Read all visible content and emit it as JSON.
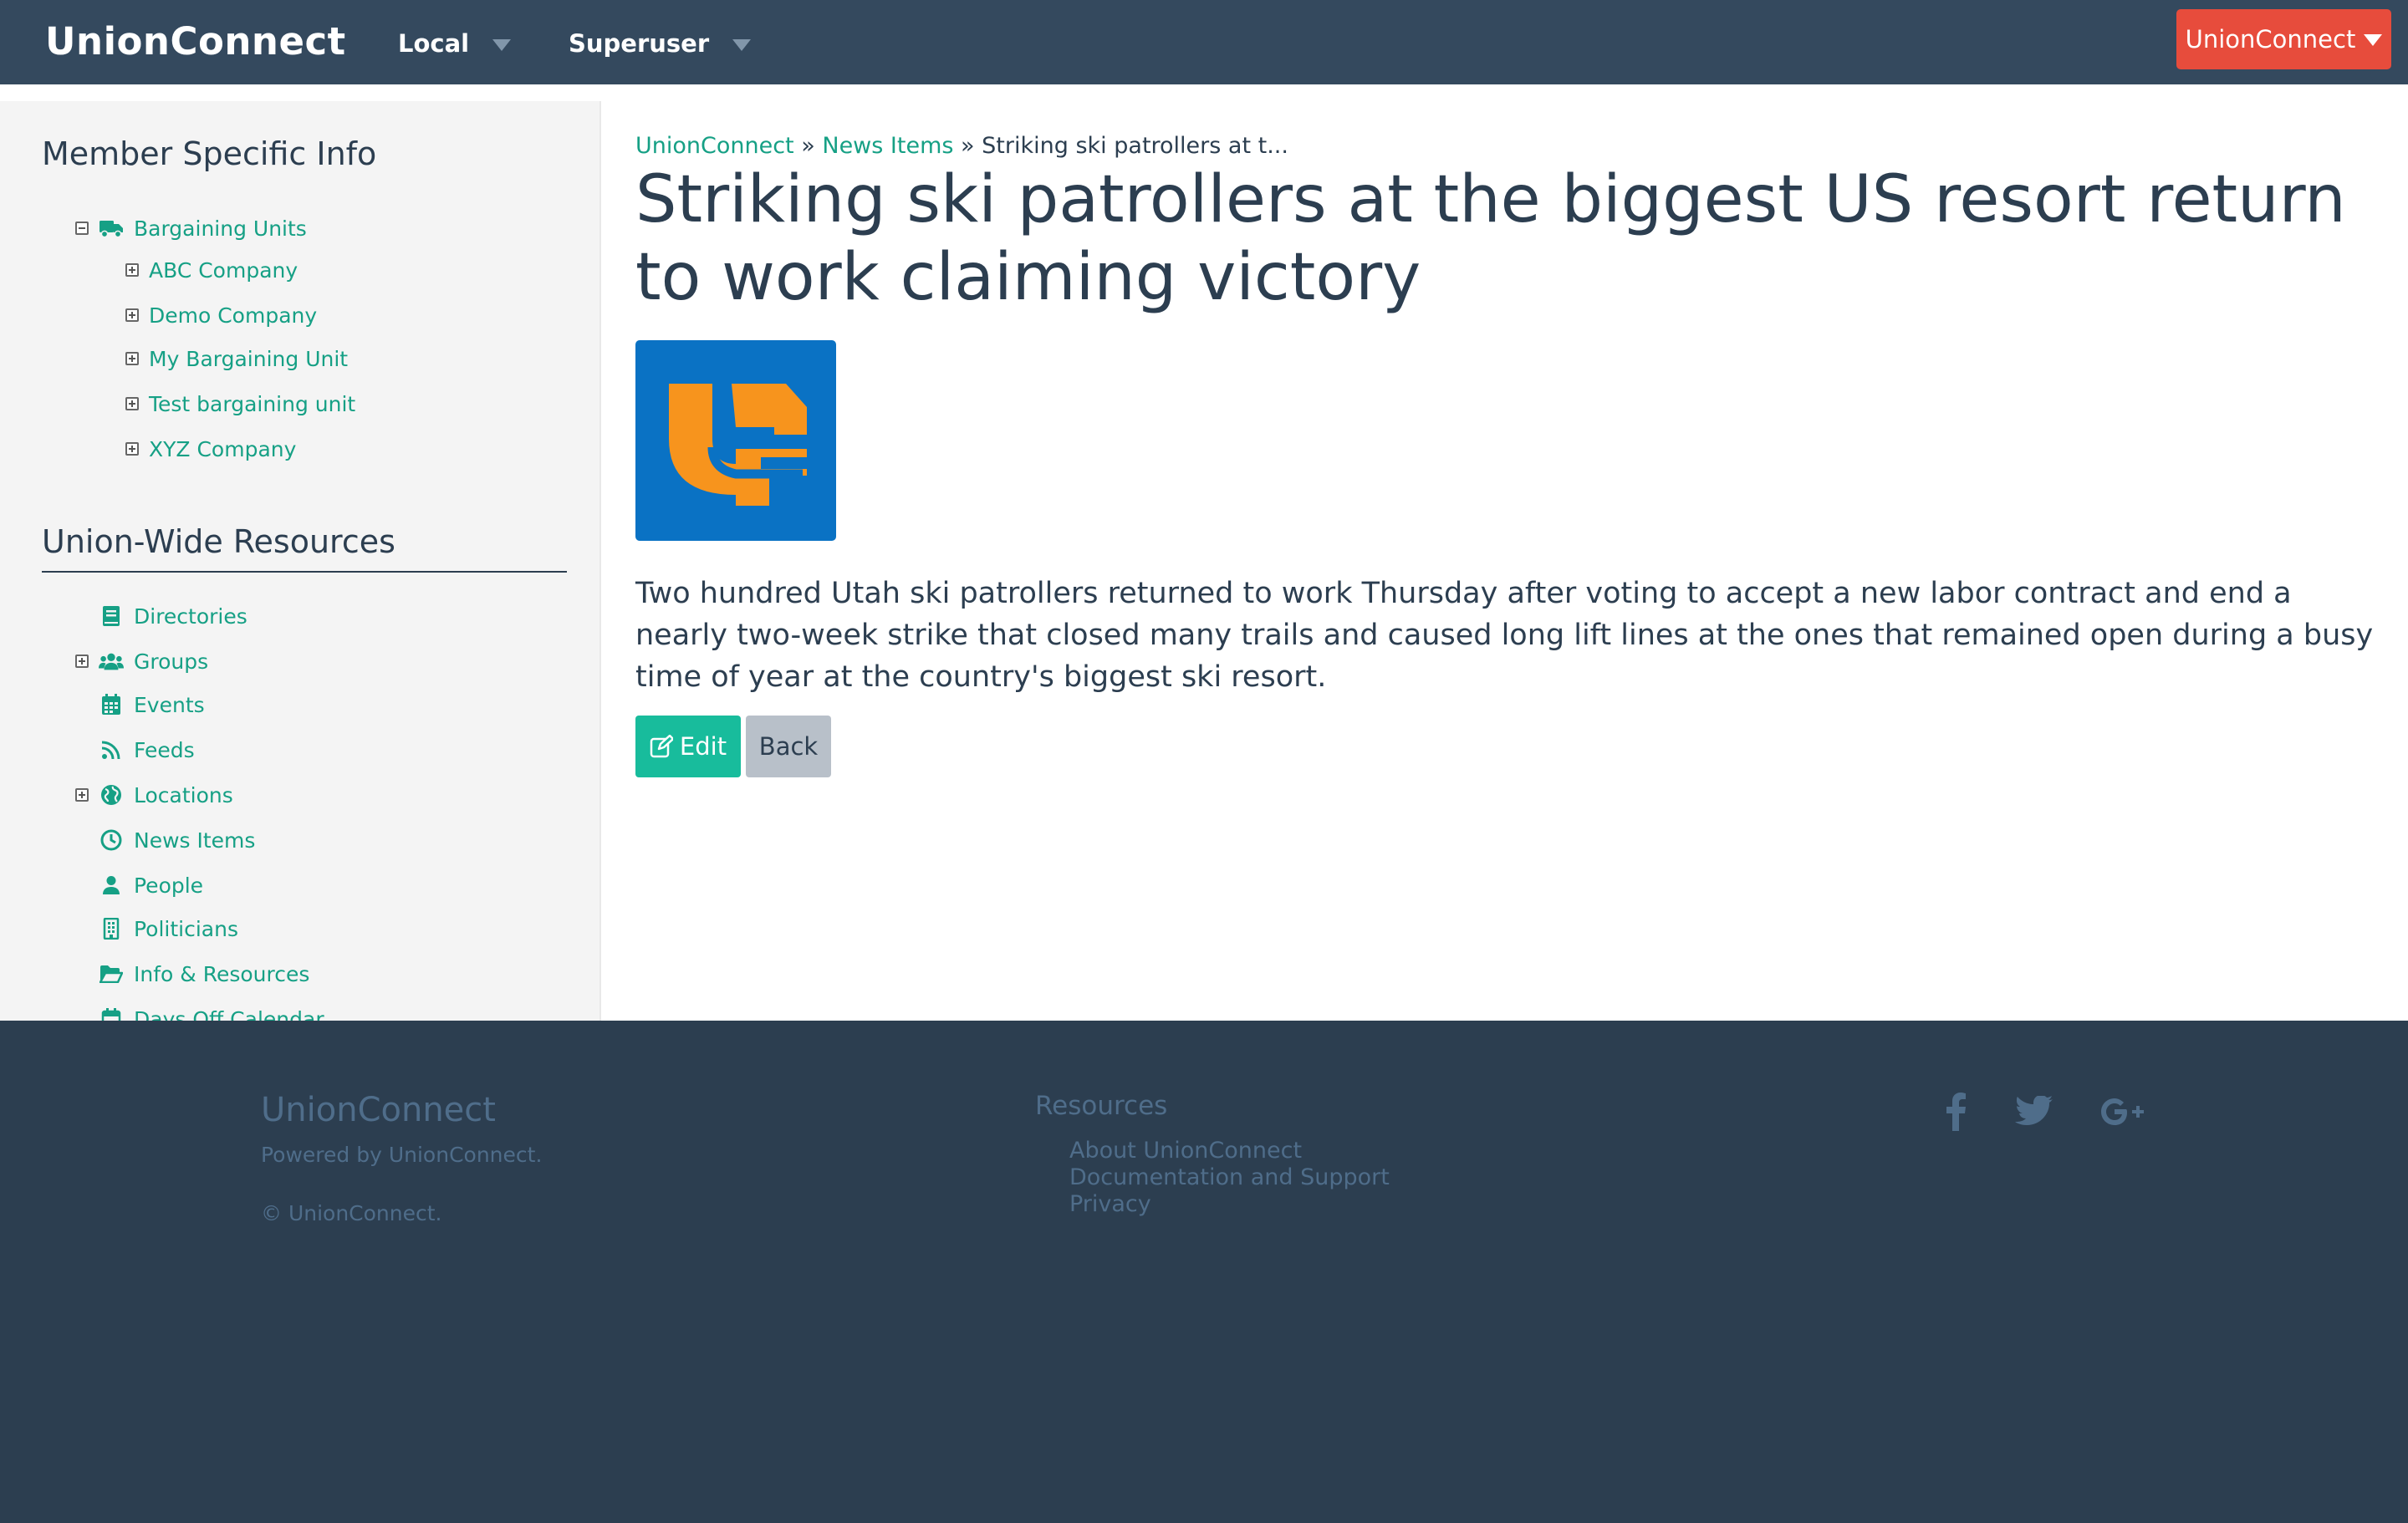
{
  "navbar": {
    "brand": "UnionConnect",
    "menus": [
      "Local",
      "Superuser"
    ],
    "user_menu": "UnionConnect"
  },
  "sidebar": {
    "member_heading": "Member Specific Info",
    "bargaining_root": "Bargaining Units",
    "bargaining_units": [
      "ABC Company",
      "Demo Company",
      "My Bargaining Unit",
      "Test bargaining unit",
      "XYZ Company"
    ],
    "resources_heading": "Union-Wide Resources",
    "resources": [
      {
        "label": "Directories",
        "icon": "book-icon"
      },
      {
        "label": "Groups",
        "icon": "users-icon"
      },
      {
        "label": "Events",
        "icon": "calendar-icon"
      },
      {
        "label": "Feeds",
        "icon": "rss-icon"
      },
      {
        "label": "Locations",
        "icon": "globe-icon"
      },
      {
        "label": "News Items",
        "icon": "clock-icon"
      },
      {
        "label": "People",
        "icon": "user-icon"
      },
      {
        "label": "Politicians",
        "icon": "building-icon"
      },
      {
        "label": "Info & Resources",
        "icon": "folder-open-icon"
      },
      {
        "label": "Days Off Calendar",
        "icon": "calendar-outline-icon"
      }
    ]
  },
  "breadcrumb": {
    "home": "UnionConnect",
    "section": "News Items",
    "separator": "»",
    "current": "Striking ski patrollers at t..."
  },
  "article": {
    "title": "Striking ski patrollers at the biggest US resort return to work claiming victory",
    "body": "Two hundred Utah ski patrollers returned to work Thursday after voting to accept a new labor contract and end a nearly two-week strike that closed many trails and caused long lift lines at the ones that remained open during a busy time of year at the country's biggest ski resort.",
    "edit_label": "Edit",
    "back_label": "Back"
  },
  "footer": {
    "brand": "UnionConnect",
    "powered": "Powered by UnionConnect.",
    "copyright": "© UnionConnect.",
    "resources_title": "Resources",
    "links": [
      "About UnionConnect",
      "Documentation and Support",
      "Privacy"
    ]
  },
  "colors": {
    "navbar": "#34495e",
    "accent_green": "#16a085",
    "button_green": "#18bc9c",
    "user_menu_red": "#e74c3c",
    "footer": "#2c3e50",
    "footer_text": "#4f6d8a",
    "logo_blue": "#0a72c4",
    "logo_orange": "#f7941d"
  }
}
